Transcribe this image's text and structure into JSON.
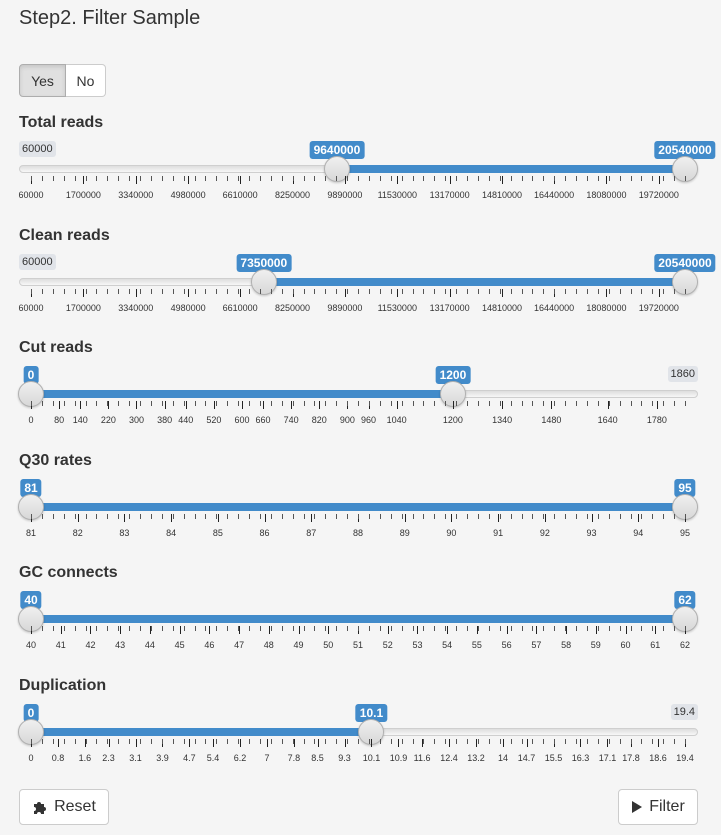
{
  "title": "Step2. Filter Sample",
  "toggle": {
    "yes_label": "Yes",
    "no_label": "No",
    "selected": "Yes"
  },
  "sliders": [
    {
      "id": "total-reads",
      "label": "Total reads",
      "min_label": "60000",
      "min": 60000,
      "max": 20540000,
      "from": 9640000,
      "to": 20540000,
      "from_label": "9640000",
      "to_label": "20540000",
      "range_type": "double",
      "major_ticks": [
        "60000",
        "1700000",
        "3340000",
        "4980000",
        "6610000",
        "8250000",
        "9890000",
        "11530000",
        "13170000",
        "14810000",
        "16440000",
        "18080000",
        "19720000"
      ]
    },
    {
      "id": "clean-reads",
      "label": "Clean reads",
      "min_label": "60000",
      "min": 60000,
      "max": 20540000,
      "from": 7350000,
      "to": 20540000,
      "from_label": "7350000",
      "to_label": "20540000",
      "range_type": "double",
      "major_ticks": [
        "60000",
        "1700000",
        "3340000",
        "4980000",
        "6610000",
        "8250000",
        "9890000",
        "11530000",
        "13170000",
        "14810000",
        "16440000",
        "18080000",
        "19720000"
      ]
    },
    {
      "id": "cut-reads",
      "label": "Cut reads",
      "max_label": "1860",
      "min": 0,
      "max": 1860,
      "from": 0,
      "to": 1200,
      "from_label": "0",
      "to_label": "1200",
      "range_type": "double",
      "major_ticks": [
        "0",
        "80",
        "140",
        "220",
        "300",
        "380",
        "440",
        "520",
        "600",
        "660",
        "740",
        "820",
        "900",
        "960",
        "1040",
        "1200",
        "1340",
        "1480",
        "1640",
        "1780"
      ]
    },
    {
      "id": "q30-rates",
      "label": "Q30 rates",
      "min": 81,
      "max": 95,
      "from": 81,
      "to": 95,
      "from_label": "81",
      "to_label": "95",
      "range_type": "double",
      "major_ticks": [
        "81",
        "82",
        "83",
        "84",
        "85",
        "86",
        "87",
        "88",
        "89",
        "90",
        "91",
        "92",
        "93",
        "94",
        "95"
      ]
    },
    {
      "id": "gc-connects",
      "label": "GC connects",
      "min": 40,
      "max": 62,
      "from": 40,
      "to": 62,
      "from_label": "40",
      "to_label": "62",
      "range_type": "double",
      "major_ticks": [
        "40",
        "41",
        "42",
        "43",
        "44",
        "45",
        "46",
        "47",
        "48",
        "49",
        "50",
        "51",
        "52",
        "53",
        "54",
        "55",
        "56",
        "57",
        "58",
        "59",
        "60",
        "61",
        "62"
      ]
    },
    {
      "id": "duplication",
      "label": "Duplication",
      "max_label": "19.4",
      "min": 0,
      "max": 19.4,
      "from": 0,
      "to": 10.1,
      "from_label": "0",
      "to_label": "10.1",
      "range_type": "double",
      "major_ticks": [
        "0",
        "0.8",
        "1.6",
        "2.3",
        "3.1",
        "3.9",
        "4.7",
        "5.4",
        "6.2",
        "7",
        "7.8",
        "8.5",
        "9.3",
        "10.1",
        "10.9",
        "11.6",
        "12.4",
        "13.2",
        "14",
        "14.7",
        "15.5",
        "16.3",
        "17.1",
        "17.8",
        "18.6",
        "19.4"
      ]
    }
  ],
  "buttons": {
    "reset_label": "Reset",
    "filter_label": "Filter",
    "reset_icon": "puzzle-icon",
    "filter_icon": "play-icon"
  },
  "colors": {
    "accent": "#428bca",
    "background": "#f5f5f5"
  }
}
